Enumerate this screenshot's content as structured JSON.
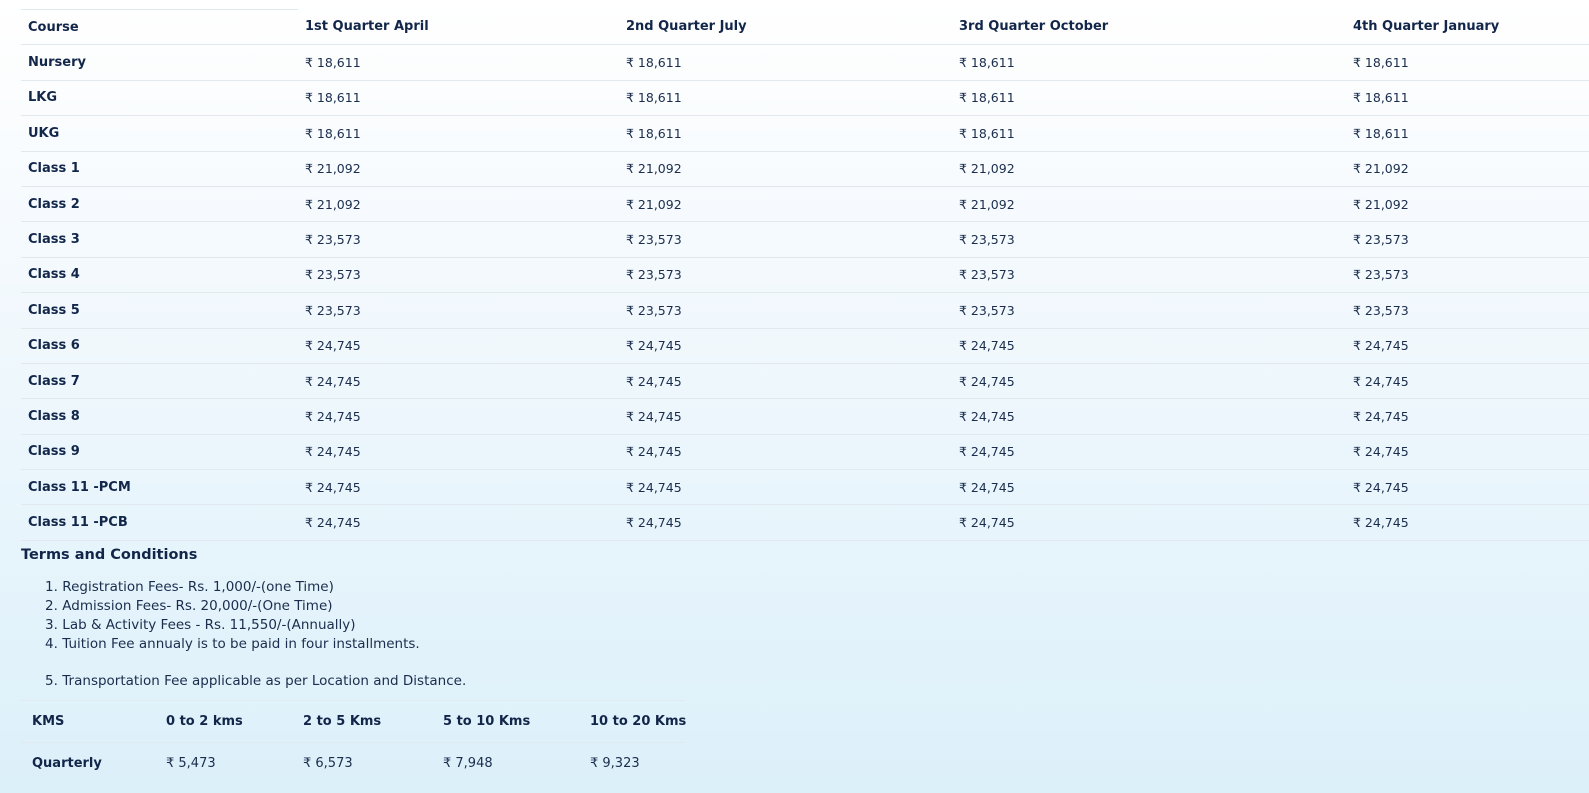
{
  "fee_table": {
    "headers": [
      "Course",
      "1st Quarter April",
      "2nd Quarter July",
      "3rd Quarter October",
      "4th Quarter January"
    ],
    "rows": [
      {
        "course": "Nursery",
        "fees": [
          "₹ 18,611",
          "₹ 18,611",
          "₹ 18,611",
          "₹ 18,611"
        ]
      },
      {
        "course": "LKG",
        "fees": [
          "₹ 18,611",
          "₹ 18,611",
          "₹ 18,611",
          "₹ 18,611"
        ]
      },
      {
        "course": "UKG",
        "fees": [
          "₹ 18,611",
          "₹ 18,611",
          "₹ 18,611",
          "₹ 18,611"
        ]
      },
      {
        "course": "Class 1",
        "fees": [
          "₹ 21,092",
          "₹ 21,092",
          "₹ 21,092",
          "₹ 21,092"
        ]
      },
      {
        "course": "Class 2",
        "fees": [
          "₹ 21,092",
          "₹ 21,092",
          "₹ 21,092",
          "₹ 21,092"
        ]
      },
      {
        "course": "Class 3",
        "fees": [
          "₹ 23,573",
          "₹ 23,573",
          "₹ 23,573",
          "₹ 23,573"
        ]
      },
      {
        "course": "Class 4",
        "fees": [
          "₹ 23,573",
          "₹ 23,573",
          "₹ 23,573",
          "₹ 23,573"
        ]
      },
      {
        "course": "Class 5",
        "fees": [
          "₹ 23,573",
          "₹ 23,573",
          "₹ 23,573",
          "₹ 23,573"
        ]
      },
      {
        "course": "Class 6",
        "fees": [
          "₹ 24,745",
          "₹ 24,745",
          "₹ 24,745",
          "₹ 24,745"
        ]
      },
      {
        "course": "Class 7",
        "fees": [
          "₹ 24,745",
          "₹ 24,745",
          "₹ 24,745",
          "₹ 24,745"
        ]
      },
      {
        "course": "Class 8",
        "fees": [
          "₹ 24,745",
          "₹ 24,745",
          "₹ 24,745",
          "₹ 24,745"
        ]
      },
      {
        "course": "Class 9",
        "fees": [
          "₹ 24,745",
          "₹ 24,745",
          "₹ 24,745",
          "₹ 24,745"
        ]
      },
      {
        "course": "Class 11 -PCM",
        "fees": [
          "₹ 24,745",
          "₹ 24,745",
          "₹ 24,745",
          "₹ 24,745"
        ]
      },
      {
        "course": "Class 11 -PCB",
        "fees": [
          "₹ 24,745",
          "₹ 24,745",
          "₹ 24,745",
          "₹ 24,745"
        ]
      }
    ]
  },
  "terms": {
    "title": "Terms and Conditions",
    "items": [
      {
        "num": "1.",
        "text": "Registration Fees- Rs. 1,000/-(one Time)"
      },
      {
        "num": "2.",
        "text": "Admission Fees- Rs. 20,000/-(One Time)"
      },
      {
        "num": "3.",
        "text": "Lab & Activity Fees - Rs. 11,550/-(Annually)"
      },
      {
        "num": "4.",
        "text": "Tuition Fee annualy is to be paid in four installments."
      },
      {
        "num": "5.",
        "text": "Transportation Fee applicable as per Location and Distance."
      }
    ]
  },
  "transport_table": {
    "headers": [
      "KMS",
      "0 to 2 kms",
      "2 to 5 Kms",
      "5 to 10 Kms",
      "10 to 20 Kms"
    ],
    "row": {
      "label": "Quarterly",
      "fees": [
        "₹ 5,473",
        "₹ 6,573",
        "₹ 7,948",
        "₹ 9,323"
      ]
    }
  }
}
